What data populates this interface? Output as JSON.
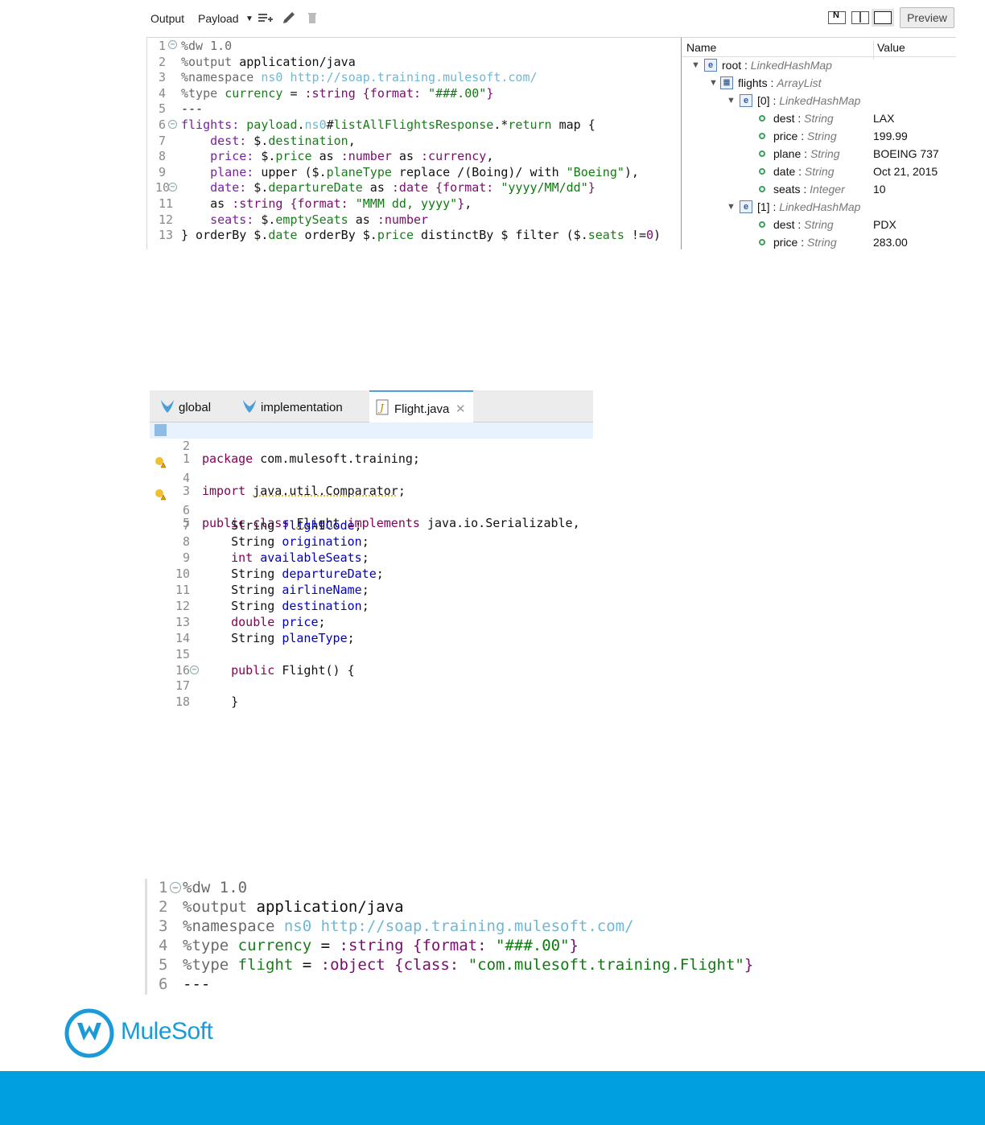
{
  "dw_toolbar": {
    "output_label": "Output",
    "payload_label": "Payload",
    "preview_label": "Preview"
  },
  "dw_script": [
    {
      "num": "1",
      "code": "%dw 1.0"
    },
    {
      "num": "2",
      "code": "%output application/java"
    },
    {
      "num": "3",
      "code": "%namespace ns0 http://soap.training.mulesoft.com/"
    },
    {
      "num": "4",
      "code": "%type currency = :string {format: \"###.00\"}"
    },
    {
      "num": "5",
      "code": "---"
    },
    {
      "num": "6",
      "code": "flights: payload.ns0#listAllFlightsResponse.*return map {"
    },
    {
      "num": "7",
      "code": "    dest: $.destination,"
    },
    {
      "num": "8",
      "code": "    price: $.price as :number as :currency,"
    },
    {
      "num": "9",
      "code": "    plane: upper ($.planeType replace /(Boing)/ with \"Boeing\"),"
    },
    {
      "num": "10",
      "code": "    date: $.departureDate as :date {format: \"yyyy/MM/dd\"}"
    },
    {
      "num": "11",
      "code": "    as :string {format: \"MMM dd, yyyy\"},"
    },
    {
      "num": "12",
      "code": "    seats: $.emptySeats as :number"
    },
    {
      "num": "13",
      "code": "} orderBy $.date orderBy $.price distinctBy $ filter ($.seats !=0)"
    }
  ],
  "tree": {
    "header_name": "Name",
    "header_value": "Value",
    "rows": [
      {
        "name": "root",
        "type": "LinkedHashMap",
        "value": ""
      },
      {
        "name": "flights",
        "type": "ArrayList",
        "value": ""
      },
      {
        "name": "[0]",
        "type": "LinkedHashMap",
        "value": ""
      },
      {
        "name": "dest",
        "type": "String",
        "value": "LAX"
      },
      {
        "name": "price",
        "type": "String",
        "value": "199.99"
      },
      {
        "name": "plane",
        "type": "String",
        "value": "BOEING 737"
      },
      {
        "name": "date",
        "type": "String",
        "value": "Oct 21, 2015"
      },
      {
        "name": "seats",
        "type": "Integer",
        "value": "10"
      },
      {
        "name": "[1]",
        "type": "LinkedHashMap",
        "value": ""
      },
      {
        "name": "dest",
        "type": "String",
        "value": "PDX"
      },
      {
        "name": "price",
        "type": "String",
        "value": "283.00"
      }
    ],
    "separator": " : "
  },
  "java_tabs": [
    {
      "label": "global"
    },
    {
      "label": "implementation"
    },
    {
      "label": "Flight.java"
    }
  ],
  "java_code": [
    {
      "num": "1",
      "code": "package com.mulesoft.training;"
    },
    {
      "num": "2",
      "code": ""
    },
    {
      "num": "3",
      "code": "import java.util.Comparator;"
    },
    {
      "num": "4",
      "code": ""
    },
    {
      "num": "5",
      "code": "public class Flight implements java.io.Serializable,"
    },
    {
      "num": "6",
      "code": ""
    },
    {
      "num": "7",
      "code": "    String flightCode;"
    },
    {
      "num": "8",
      "code": "    String origination;"
    },
    {
      "num": "9",
      "code": "    int availableSeats;"
    },
    {
      "num": "10",
      "code": "    String departureDate;"
    },
    {
      "num": "11",
      "code": "    String airlineName;"
    },
    {
      "num": "12",
      "code": "    String destination;"
    },
    {
      "num": "13",
      "code": "    double price;"
    },
    {
      "num": "14",
      "code": "    String planeType;"
    },
    {
      "num": "15",
      "code": ""
    },
    {
      "num": "16",
      "code": "    public Flight() {"
    },
    {
      "num": "17",
      "code": ""
    },
    {
      "num": "18",
      "code": "    }"
    }
  ],
  "dw_header": [
    {
      "num": "1",
      "code": "%dw 1.0"
    },
    {
      "num": "2",
      "code": "%output application/java"
    },
    {
      "num": "3",
      "code": "%namespace ns0 http://soap.training.mulesoft.com/"
    },
    {
      "num": "4",
      "code": "%type currency = :string {format: \"###.00\"}"
    },
    {
      "num": "5",
      "code": "%type flight = :object {class: \"com.mulesoft.training.Flight\"}"
    },
    {
      "num": "6",
      "code": "---"
    }
  ],
  "brand": {
    "name": "MuleSoft",
    "color": "#009fdf"
  }
}
